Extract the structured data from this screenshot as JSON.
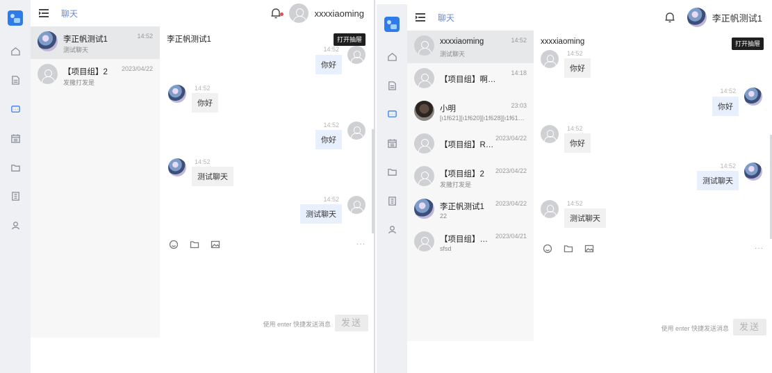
{
  "left_window": {
    "header": {
      "title": "聊天",
      "user_name": "xxxxiaoming"
    },
    "conversations": [
      {
        "name": "李正帆测试1",
        "last_message": "测试聊天",
        "time": "14:52",
        "avatar": "anime",
        "active": true
      },
      {
        "name": "【项目组】2",
        "last_message": "发撒打发是",
        "time": "2023/04/22",
        "avatar": "default",
        "active": false
      }
    ],
    "chat": {
      "title": "李正帆测试1",
      "drawer_button": "打开抽屉",
      "messages": [
        {
          "side": "mine",
          "time": "14:52",
          "text": "你好",
          "partial": true
        },
        {
          "side": "theirs",
          "time": "14:52",
          "text": "你好"
        },
        {
          "side": "mine",
          "time": "14:52",
          "text": "你好"
        },
        {
          "side": "theirs",
          "time": "14:52",
          "text": "测试聊天"
        },
        {
          "side": "mine",
          "time": "14:52",
          "text": "测试聊天"
        }
      ],
      "more": "···",
      "input_hint": "使用 enter 快捷发送消息",
      "send_label": "发送"
    }
  },
  "right_window": {
    "header": {
      "title": "聊天",
      "user_name": "李正帆测试1"
    },
    "conversations": [
      {
        "name": "xxxxiaoming",
        "last_message": "测试聊天",
        "time": "14:52",
        "avatar": "default",
        "active": true
      },
      {
        "name": "【项目组】啊啊撒",
        "last_message": "",
        "time": "14:18",
        "avatar": "default",
        "active": false
      },
      {
        "name": "小明",
        "last_message": "[ı1f621][ı1f620][ı1f628][ı1f618...",
        "time": "23:03",
        "avatar": "photo",
        "active": false
      },
      {
        "name": "【项目组】RNG",
        "last_message": "",
        "time": "2023/04/22",
        "avatar": "default",
        "active": false
      },
      {
        "name": "【项目组】2",
        "last_message": "发撒打发是",
        "time": "2023/04/22",
        "avatar": "default",
        "active": false
      },
      {
        "name": "李正帆测试1",
        "last_message": "22",
        "time": "2023/04/22",
        "avatar": "anime",
        "active": false
      },
      {
        "name": "【项目组】啊...",
        "last_message": "sfsd",
        "time": "2023/04/21",
        "avatar": "default",
        "active": false
      }
    ],
    "chat": {
      "title": "xxxxiaoming",
      "drawer_button": "打开抽屉",
      "messages": [
        {
          "side": "theirs",
          "time": "14:52",
          "text": "你好",
          "partial": true
        },
        {
          "side": "mine",
          "time": "14:52",
          "text": "你好"
        },
        {
          "side": "theirs",
          "time": "14:52",
          "text": "你好"
        },
        {
          "side": "mine",
          "time": "14:52",
          "text": "测试聊天"
        },
        {
          "side": "theirs",
          "time": "14:52",
          "text": "测试聊天"
        }
      ],
      "more": "···",
      "input_hint": "使用 enter 快捷发送消息",
      "send_label": "发送"
    }
  },
  "icons": [
    "app-logo-icon",
    "home-icon",
    "document-icon",
    "chat-icon",
    "calendar-icon",
    "folder-icon",
    "notebook-icon",
    "user-icon",
    "menu-collapse-icon",
    "bell-icon",
    "emoji-icon",
    "folder-icon",
    "image-icon"
  ],
  "colors": {
    "accent": "#3b7cf5",
    "sidebar_bg": "#eef0f4",
    "my_bubble": "#e9f0fd",
    "their_bubble": "#f1f1f2",
    "notification_dot": "#e84c4c"
  }
}
